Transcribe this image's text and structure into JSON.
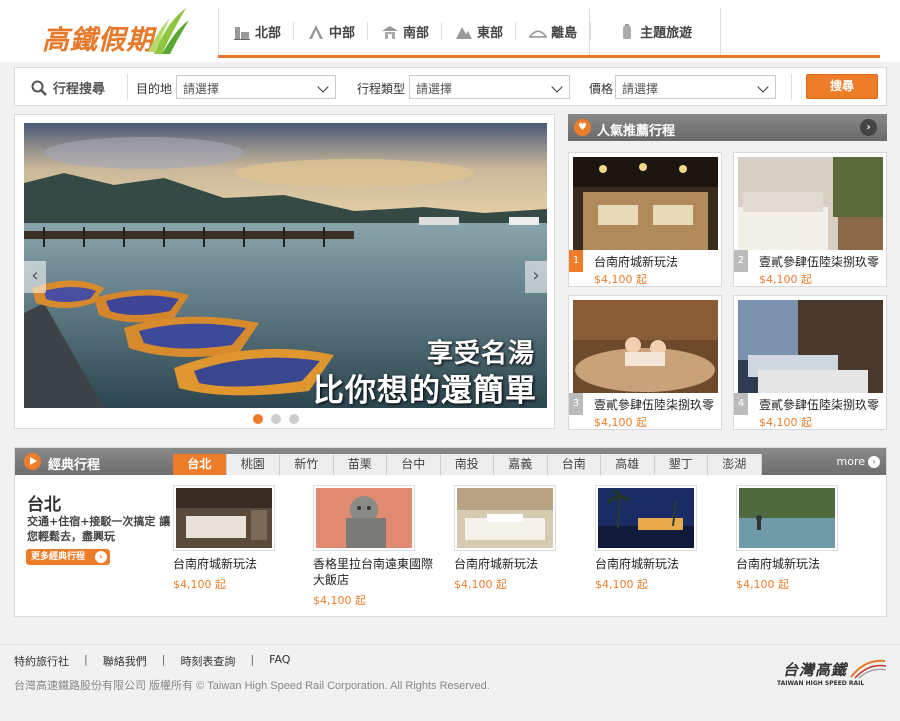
{
  "brand": {
    "logo_text": "高鐵假期",
    "accent": "#ee7d2a"
  },
  "nav": {
    "items": [
      {
        "label": "北部",
        "icon": "building-icon"
      },
      {
        "label": "中部",
        "icon": "tower-icon"
      },
      {
        "label": "南部",
        "icon": "temple-icon"
      },
      {
        "label": "東部",
        "icon": "mountain-icon"
      },
      {
        "label": "離島",
        "icon": "bridge-icon"
      },
      {
        "label": "主題旅遊",
        "icon": "lantern-icon"
      }
    ]
  },
  "search": {
    "title": "行程搜尋",
    "destination_label": "目的地",
    "destination_value": "請選擇",
    "type_label": "行程類型",
    "type_value": "請選擇",
    "price_label": "價格",
    "price_value": "請選擇",
    "button": "搜尋"
  },
  "slideshow": {
    "caption_line1": "享受名湯",
    "caption_line2": "比你想的還簡單",
    "prev": "‹",
    "next": "›",
    "dots": 3,
    "active_dot": 0
  },
  "popular": {
    "title": "人氣推薦行程",
    "more": "›",
    "items": [
      {
        "rank": "1",
        "name": "台南府城新玩法",
        "price": "$4,100 起"
      },
      {
        "rank": "2",
        "name": "壹貳參肆伍陸柒捌玖零",
        "price": "$4,100 起"
      },
      {
        "rank": "3",
        "name": "壹貳參肆伍陸柒捌玖零",
        "price": "$4,100 起"
      },
      {
        "rank": "4",
        "name": "壹貳參肆伍陸柒捌玖零",
        "price": "$4,100 起"
      }
    ]
  },
  "classic": {
    "title": "經典行程",
    "tabs": [
      "台北",
      "桃園",
      "新竹",
      "苗栗",
      "台中",
      "南投",
      "嘉義",
      "台南",
      "高雄",
      "墾丁",
      "澎湖"
    ],
    "active_tab": 0,
    "more": "more",
    "region": "台北",
    "region_desc": "交通+住宿+接駁一次搞定 讓您輕鬆去，盡興玩",
    "more_button": "更多經典行程",
    "items": [
      {
        "name": "台南府城新玩法",
        "price": "$4,100 起"
      },
      {
        "name": "香格里拉台南遠東國際大飯店",
        "price": "$4,100 起"
      },
      {
        "name": "台南府城新玩法",
        "price": "$4,100 起"
      },
      {
        "name": "台南府城新玩法",
        "price": "$4,100 起"
      },
      {
        "name": "台南府城新玩法",
        "price": "$4,100 起"
      }
    ]
  },
  "footer": {
    "links": [
      "特約旅行社",
      "聯絡我們",
      "時刻表查詢",
      "FAQ"
    ],
    "separator": "|",
    "copyright": "台灣高速鐵路股份有限公司 版權所有 © Taiwan High Speed Rail Corporation. All Rights Reserved.",
    "logo_cn": "台灣高鐵",
    "logo_en": "TAIWAN HIGH SPEED RAIL"
  }
}
